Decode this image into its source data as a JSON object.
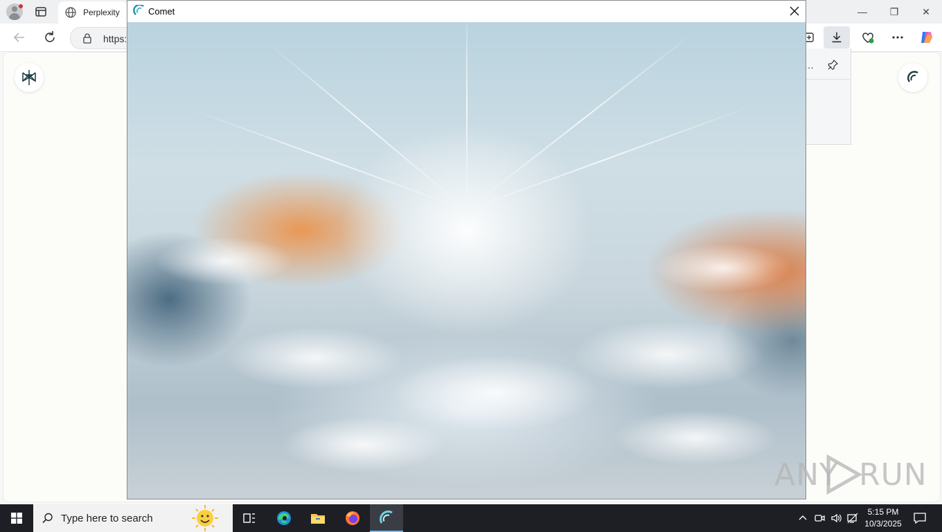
{
  "browser": {
    "tab_title": "Perplexity",
    "address_text": "https:",
    "icons": [
      "profile-icon",
      "tab-actions-icon",
      "globe-icon",
      "back-icon",
      "refresh-icon",
      "lock-icon",
      "collections-icon",
      "download-icon",
      "browser-essentials-icon",
      "more-icon",
      "copilot-icon",
      "pin-icon"
    ]
  },
  "window_controls": {
    "minimize": "—",
    "restore": "❐",
    "close": "✕"
  },
  "comet_window": {
    "title": "Comet"
  },
  "watermark": {
    "left": "ANY",
    "right": "RUN"
  },
  "taskbar": {
    "search_placeholder": "Type here to search",
    "time": "5:15 PM",
    "date": "10/3/2025",
    "apps": [
      "task-view",
      "edge",
      "file-explorer",
      "firefox",
      "comet"
    ]
  },
  "colors": {
    "taskbar": "#1d1f25",
    "accent": "#76b9ed",
    "comet_teal": "#1f7f90"
  }
}
